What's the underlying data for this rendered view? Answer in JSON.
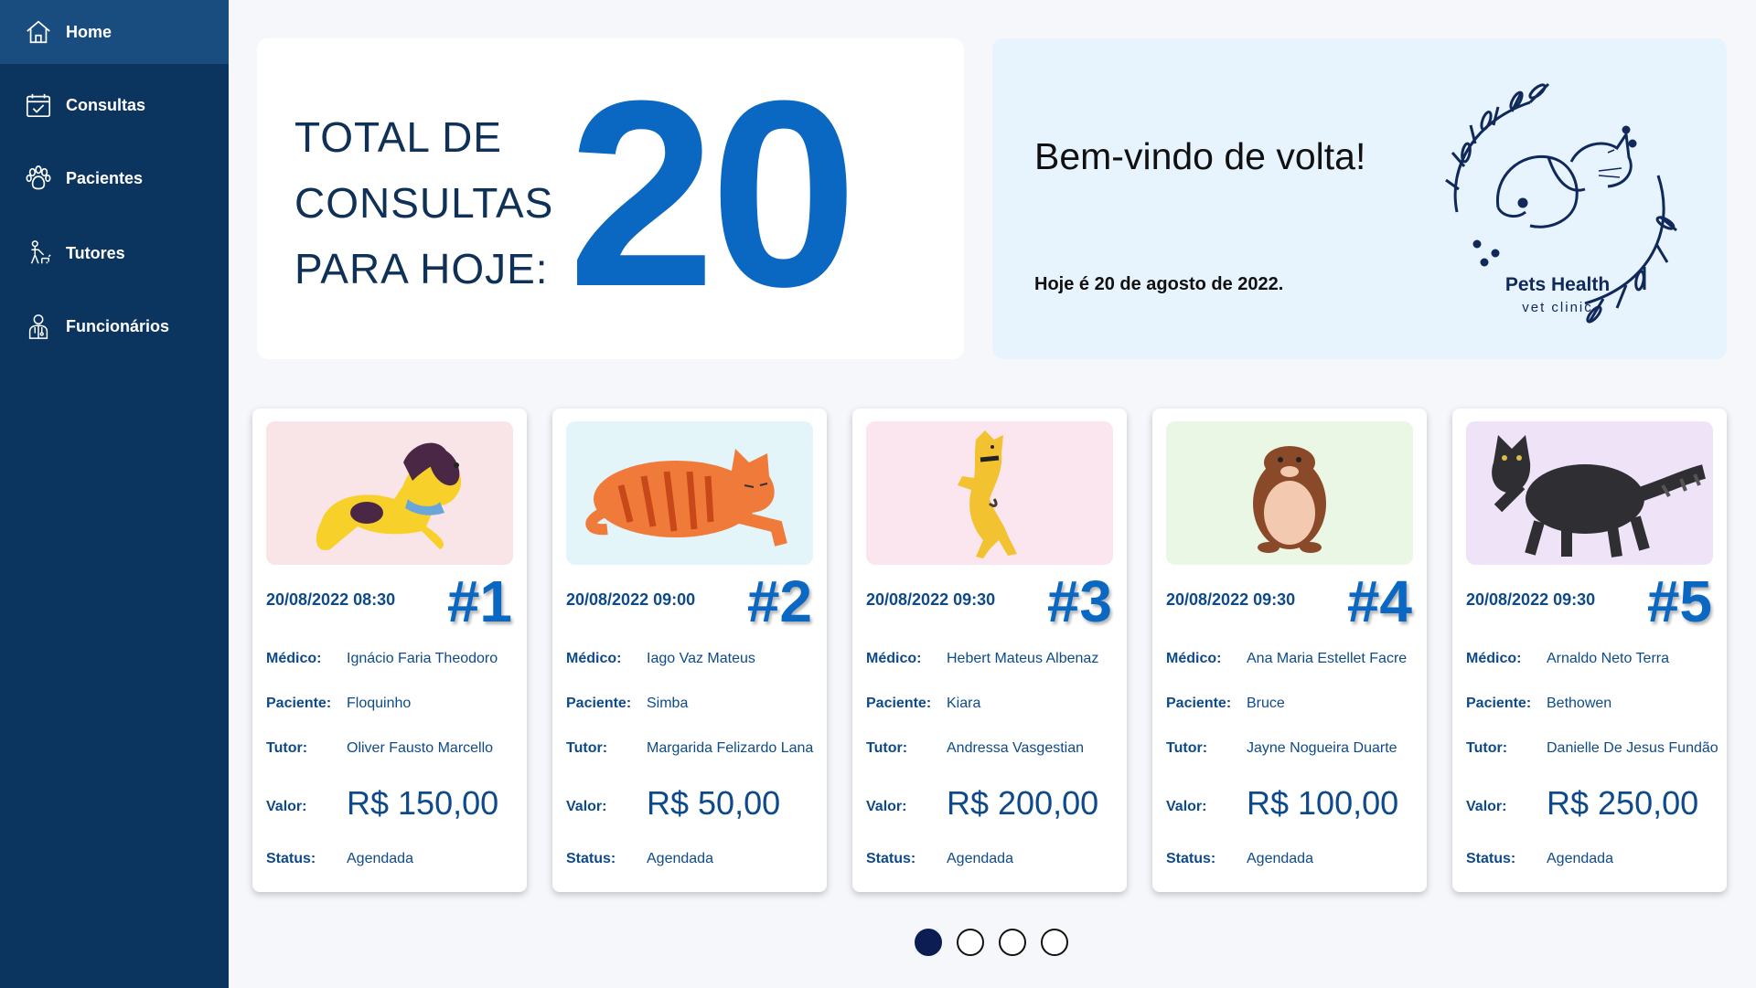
{
  "sidebar": {
    "items": [
      {
        "label": "Home",
        "icon": "home-icon"
      },
      {
        "label": "Consultas",
        "icon": "calendar-check-icon"
      },
      {
        "label": "Pacientes",
        "icon": "paw-icon"
      },
      {
        "label": "Tutores",
        "icon": "dog-walker-icon"
      },
      {
        "label": "Funcionários",
        "icon": "doctor-icon"
      }
    ]
  },
  "summary": {
    "label_lines": [
      "TOTAL DE",
      "CONSULTAS",
      "PARA HOJE:"
    ],
    "total": "20"
  },
  "welcome": {
    "title": "Bem-vindo de volta!",
    "date": "Hoje é 20 de agosto de 2022.",
    "logo_name": "Pets Health",
    "logo_sub": "vet clinic"
  },
  "field_labels": {
    "medico": "Médico:",
    "paciente": "Paciente:",
    "tutor": "Tutor:",
    "valor": "Valor:",
    "status": "Status:"
  },
  "appointments": [
    {
      "datetime": "20/08/2022 08:30",
      "number": "#1",
      "medico": "Ignácio Faria Theodoro",
      "paciente": "Floquinho",
      "tutor": "Oliver Fausto Marcello",
      "valor": "R$ 150,00",
      "status": "Agendada",
      "animal": "dog",
      "bg": "#f9e4e7"
    },
    {
      "datetime": "20/08/2022 09:00",
      "number": "#2",
      "medico": "Iago Vaz Mateus",
      "paciente": "Simba",
      "tutor": "Margarida Felizardo Lana",
      "valor": "R$ 50,00",
      "status": "Agendada",
      "animal": "cat-orange",
      "bg": "#e4f5fa"
    },
    {
      "datetime": "20/08/2022 09:30",
      "number": "#3",
      "medico": "Hebert Mateus Albenaz",
      "paciente": "Kiara",
      "tutor": "Andressa Vasgestian",
      "valor": "R$ 200,00",
      "status": "Agendada",
      "animal": "dog-jumping",
      "bg": "#fbe6ef"
    },
    {
      "datetime": "20/08/2022 09:30",
      "number": "#4",
      "medico": "Ana Maria Estellet Facre",
      "paciente": "Bruce",
      "tutor": "Jayne Nogueira Duarte",
      "valor": "R$ 100,00",
      "status": "Agendada",
      "animal": "hamster",
      "bg": "#eaf7e4"
    },
    {
      "datetime": "20/08/2022 09:30",
      "number": "#5",
      "medico": "Arnaldo Neto Terra",
      "paciente": "Bethowen",
      "tutor": "Danielle De Jesus Fundão",
      "valor": "R$ 250,00",
      "status": "Agendada",
      "animal": "cat-black",
      "bg": "#efe4f7"
    }
  ],
  "pagination": {
    "pages": 4,
    "current": 1
  },
  "colors": {
    "sidebar": "#0b355f",
    "sidebar_active": "#1a4d7f",
    "accent": "#0a67c2",
    "text_dark": "#0e4a8a",
    "welcome_bg": "#e7f3fd"
  }
}
